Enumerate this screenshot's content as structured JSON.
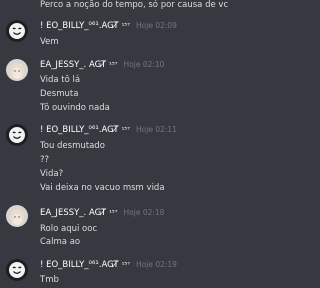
{
  "messages": {
    "top_text": "Perco a noção do tempo, só por causa de vc",
    "g1": {
      "username": "!    EO_BILLY_⁰⁶¹.AGT̸",
      "tag": "¹⁵⁷",
      "time": "Hoje 02:09",
      "lines": [
        "Vem"
      ]
    },
    "g2": {
      "username": "EA_JESSY_. AGT̸",
      "tag": "¹⁵⁷",
      "time": "Hoje 02:10",
      "lines": [
        "Vida tô lá",
        "Desmuta",
        "Tô ouvindo nada"
      ]
    },
    "g3": {
      "username": "!    EO_BILLY_⁰⁶¹.AGT̸",
      "tag": "¹⁵⁷",
      "time": "Hoje 02:11",
      "lines": [
        "Tou desmutado",
        "??",
        "Vida?",
        "Vai deixa no vacuo msm vida"
      ]
    },
    "g4": {
      "username": "EA_JESSY_. AGT̸",
      "tag": "¹⁵⁷",
      "time": "Hoje 02:18",
      "lines": [
        "Rolo aqui ooc",
        "Calma ao"
      ]
    },
    "g5": {
      "username": "!    EO_BILLY_⁰⁶¹.AGT̸",
      "tag": "¹⁵⁷",
      "time": "Hoje 02:19",
      "lines": [
        "Tmb"
      ]
    }
  },
  "avatars": {
    "billy": "marshmello-avatar-icon",
    "jessy": "girl-photo-avatar-icon"
  }
}
